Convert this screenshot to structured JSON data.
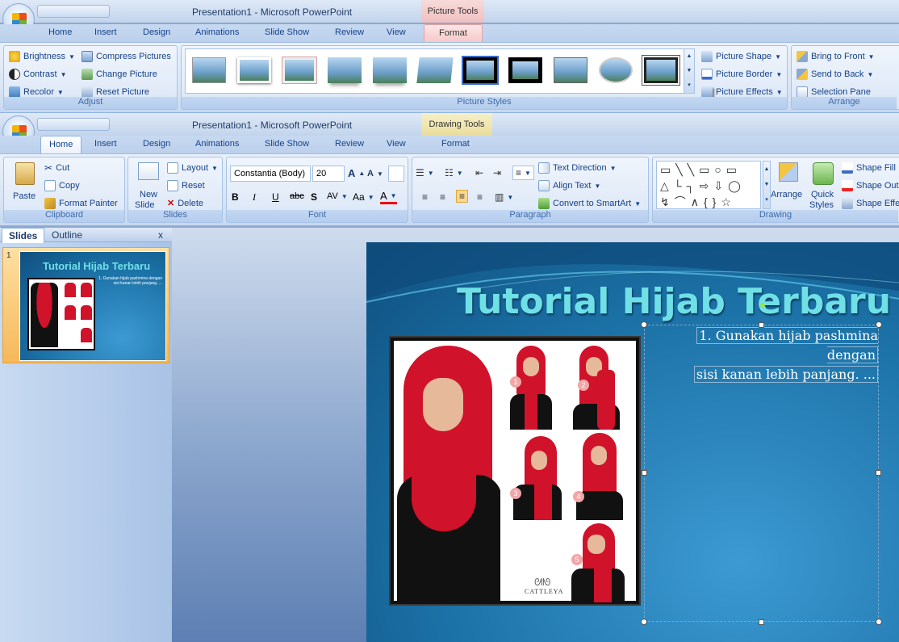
{
  "window1": {
    "title": "Presentation1 - Microsoft PowerPoint",
    "context_tab": "Picture Tools",
    "tabs": [
      "Home",
      "Insert",
      "Design",
      "Animations",
      "Slide Show",
      "Review",
      "View"
    ],
    "active_tab": "Format"
  },
  "picture_ribbon": {
    "adjust": {
      "label": "Adjust",
      "brightness": "Brightness",
      "contrast": "Contrast",
      "recolor": "Recolor",
      "compress": "Compress Pictures",
      "change": "Change Picture",
      "reset": "Reset Picture"
    },
    "styles": {
      "label": "Picture Styles",
      "shape": "Picture Shape",
      "border": "Picture Border",
      "effects": "Picture Effects"
    },
    "arrange": {
      "label": "Arrange",
      "front": "Bring to Front",
      "back": "Send to Back",
      "pane": "Selection Pane"
    }
  },
  "window2": {
    "title": "Presentation1 - Microsoft PowerPoint",
    "context_tab": "Drawing Tools",
    "tabs": [
      "Home",
      "Insert",
      "Design",
      "Animations",
      "Slide Show",
      "Review",
      "View"
    ],
    "context_sub": "Format"
  },
  "home_ribbon": {
    "clipboard": {
      "label": "Clipboard",
      "paste": "Paste",
      "cut": "Cut",
      "copy": "Copy",
      "format_painter": "Format Painter"
    },
    "slides": {
      "label": "Slides",
      "new_slide1": "New",
      "new_slide2": "Slide",
      "layout": "Layout",
      "reset": "Reset",
      "delete": "Delete"
    },
    "font": {
      "label": "Font",
      "family": "Constantia (Body)",
      "size": "20"
    },
    "paragraph": {
      "label": "Paragraph",
      "text_direction": "Text Direction",
      "align_text": "Align Text",
      "smartart": "Convert to SmartArt"
    },
    "drawing": {
      "label": "Drawing",
      "arrange": "Arrange",
      "quick1": "Quick",
      "quick2": "Styles",
      "fill": "Shape Fill",
      "outline": "Shape Out",
      "effects": "Shape Effe"
    }
  },
  "panel": {
    "tab_slides": "Slides",
    "tab_outline": "Outline",
    "close": "x",
    "slide_num": "1"
  },
  "slide": {
    "title": "Tutorial Hijab Terbaru",
    "bullet_line1": "1. Gunakan hijab pashmina dengan",
    "bullet_line2": "sisi kanan lebih panjang. ...",
    "thumb_title": "Tutorial Hijab Terbaru",
    "thumb_text": "1. Gunakan hijab pashmina dengan sisi kanan lebih panjang. ...",
    "brand": "CATTLEYA",
    "steps": [
      "1",
      "2",
      "3",
      "4",
      "5"
    ]
  },
  "colors": {
    "accent": "#15428b",
    "slide_title": "#6fe0e6",
    "hijab_red": "#d0122a"
  }
}
